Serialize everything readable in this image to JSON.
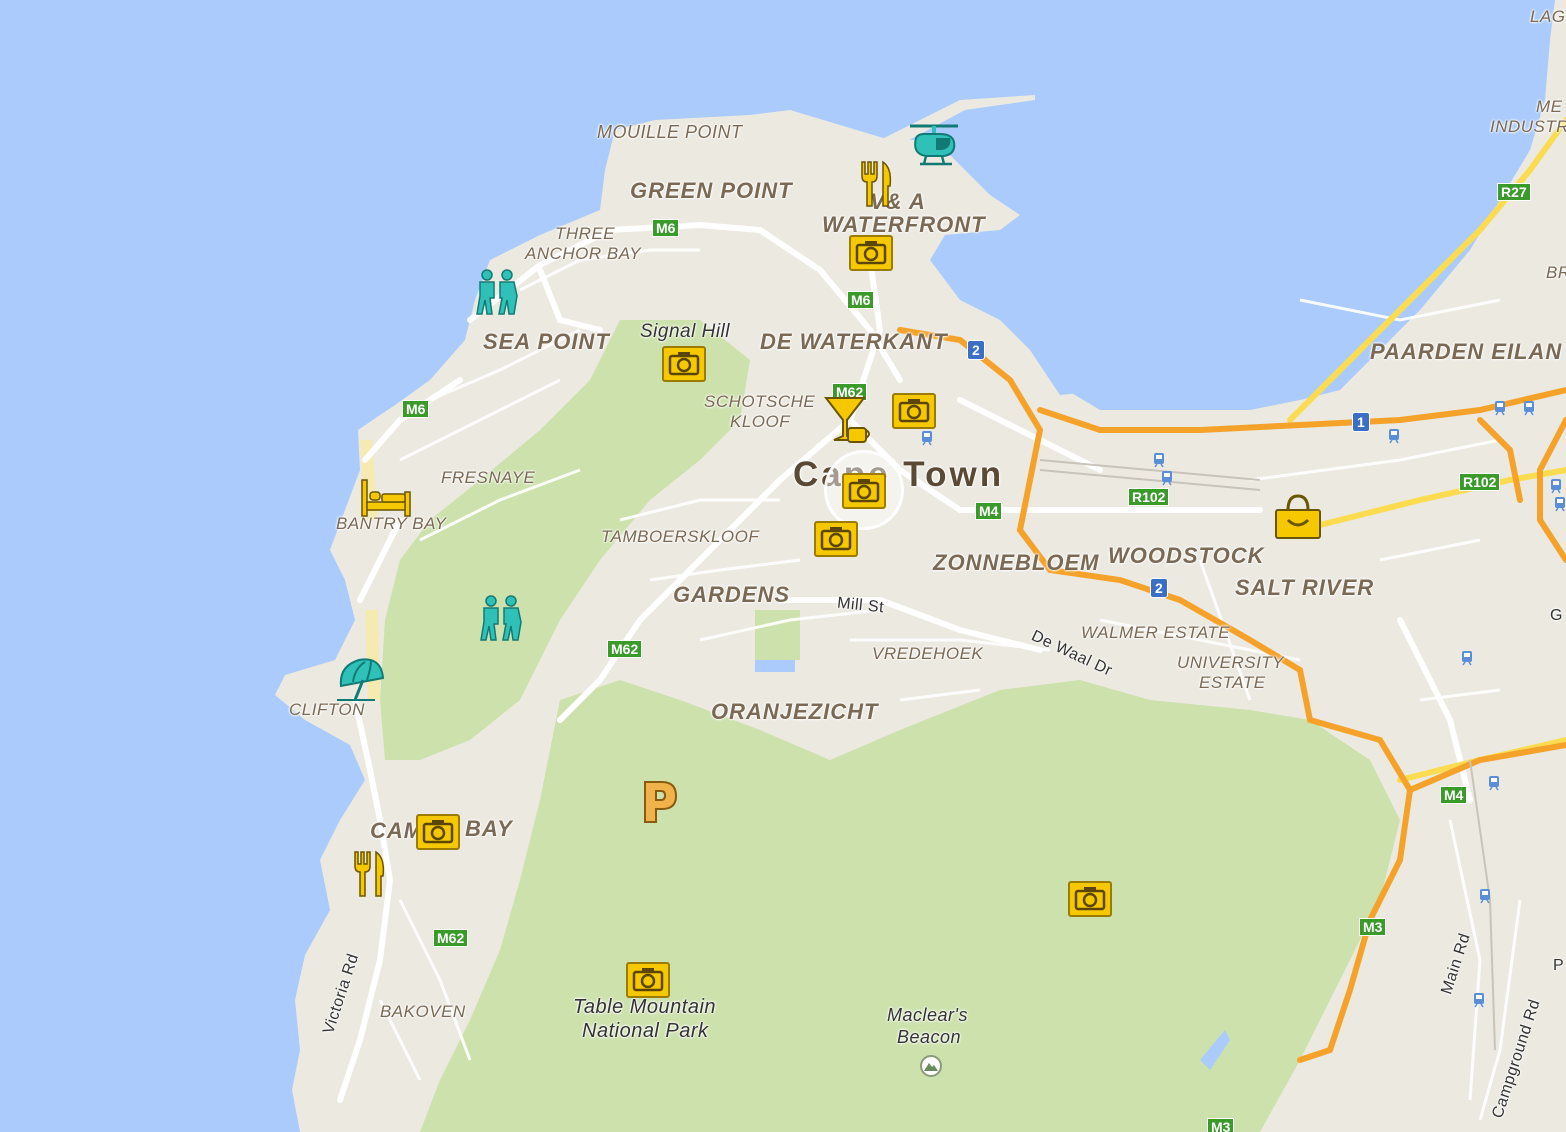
{
  "map": {
    "city_label": "Cape Town",
    "areas": [
      {
        "id": "mouille-point",
        "text": "MOUILLE POINT"
      },
      {
        "id": "green-point",
        "text": "GREEN POINT"
      },
      {
        "id": "va-waterfront-1",
        "text": "V& A"
      },
      {
        "id": "va-waterfront-2",
        "text": "WATERFRONT"
      },
      {
        "id": "three-anchor-1",
        "text": "THREE"
      },
      {
        "id": "three-anchor-2",
        "text": "ANCHOR BAY"
      },
      {
        "id": "sea-point",
        "text": "SEA POINT"
      },
      {
        "id": "de-waterkant",
        "text": "DE WATERKANT"
      },
      {
        "id": "schotsche-1",
        "text": "SCHOTSCHE"
      },
      {
        "id": "schotsche-2",
        "text": "KLOOF"
      },
      {
        "id": "fresnaye",
        "text": "FRESNAYE"
      },
      {
        "id": "bantry-bay",
        "text": "BANTRY BAY"
      },
      {
        "id": "tamboerskloof",
        "text": "TAMBOERSKLOOF"
      },
      {
        "id": "gardens",
        "text": "GARDENS"
      },
      {
        "id": "zonnebloem",
        "text": "ZONNEBLOEM"
      },
      {
        "id": "woodstock",
        "text": "WOODSTOCK"
      },
      {
        "id": "salt-river",
        "text": "SALT RIVER"
      },
      {
        "id": "walmer-estate",
        "text": "WALMER ESTATE"
      },
      {
        "id": "university-1",
        "text": "UNIVERSITY"
      },
      {
        "id": "university-2",
        "text": "ESTATE"
      },
      {
        "id": "vredehoek",
        "text": "VREDEHOEK"
      },
      {
        "id": "oranjezicht",
        "text": "ORANJEZICHT"
      },
      {
        "id": "clifton",
        "text": "CLIFTON"
      },
      {
        "id": "camps-bay-1",
        "text": "CAM"
      },
      {
        "id": "camps-bay-2",
        "text": "BAY"
      },
      {
        "id": "bakoven",
        "text": "BAKOVEN"
      },
      {
        "id": "paarden-eiland",
        "text": "PAARDEN EILAN"
      },
      {
        "id": "me",
        "text": "ME"
      },
      {
        "id": "industri",
        "text": "INDUSTRI"
      },
      {
        "id": "lag",
        "text": "LAG"
      },
      {
        "id": "br",
        "text": "BR"
      }
    ],
    "places": {
      "signal_hill": "Signal Hill",
      "table_mountain_1": "Table Mountain",
      "table_mountain_2": "National Park",
      "maclear_1": "Maclear's",
      "maclear_2": "Beacon"
    },
    "roads": {
      "mill_st": "Mill St",
      "de_waal_dr": "De Waal Dr",
      "victoria_rd": "Victoria Rd",
      "main_rd": "Main Rd",
      "campground_rd": "Campground Rd"
    },
    "shields": {
      "m6_a": "M6",
      "m6_b": "M6",
      "m6_c": "M6",
      "m62_a": "M62",
      "m62_b": "M62",
      "m62_c": "M62",
      "m4_a": "M4",
      "m4_b": "M4",
      "m3_a": "M3",
      "m3_b": "M3",
      "r27": "R27",
      "r102_a": "R102",
      "r102_b": "R102",
      "n1": "1",
      "n2_a": "2",
      "n2_b": "2"
    },
    "fragments": {
      "g": "G",
      "p": "P"
    }
  }
}
